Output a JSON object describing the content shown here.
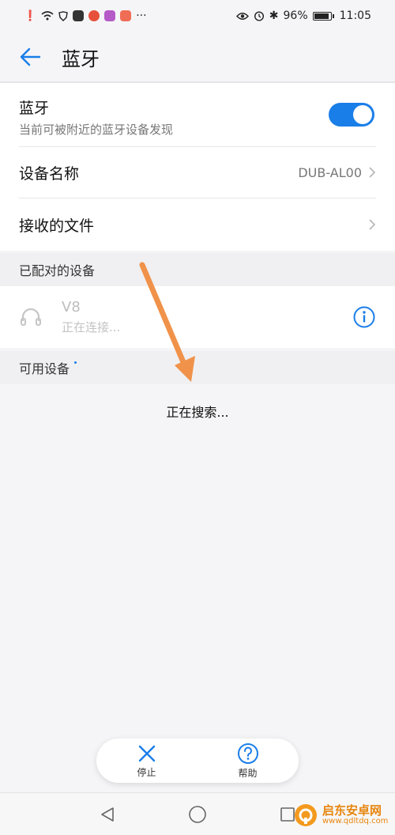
{
  "status": {
    "battery": "96%",
    "time": "11:05"
  },
  "header": {
    "title": "蓝牙"
  },
  "bluetooth": {
    "title": "蓝牙",
    "subtitle": "当前可被附近的蓝牙设备发现",
    "enabled": true
  },
  "device_name": {
    "label": "设备名称",
    "value": "DUB-AL00"
  },
  "received_files": {
    "label": "接收的文件"
  },
  "paired": {
    "header": "已配对的设备",
    "devices": [
      {
        "name": "V8",
        "status": "正在连接..."
      }
    ]
  },
  "available": {
    "header": "可用设备",
    "searching": "正在搜索..."
  },
  "bottom_actions": {
    "stop": "停止",
    "help": "帮助"
  },
  "watermark": {
    "name": "启东安卓网",
    "url": "www.qdltdq.com"
  },
  "colors": {
    "accent": "#1a7ee8",
    "annotation_arrow": "#f0924a"
  }
}
